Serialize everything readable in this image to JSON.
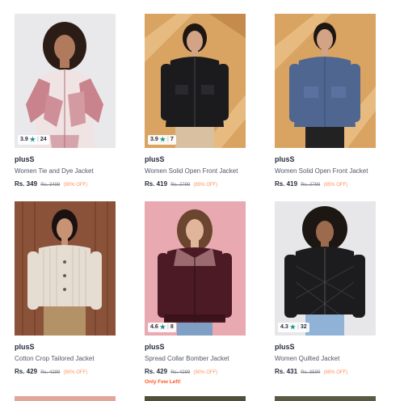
{
  "products": [
    {
      "brand": "plusS",
      "name": "Women Tie and Dye Jacket",
      "price": "Rs. 349",
      "mrp": "Rs. 3499",
      "off": "(90% OFF)",
      "rating": "3.9",
      "count": "24",
      "note": ""
    },
    {
      "brand": "plusS",
      "name": "Women Solid Open Front Jacket",
      "price": "Rs. 419",
      "mrp": "Rs. 2799",
      "off": "(85% OFF)",
      "rating": "3.9",
      "count": "7",
      "note": ""
    },
    {
      "brand": "plusS",
      "name": "Women Solid Open Front Jacket",
      "price": "Rs. 419",
      "mrp": "Rs. 2799",
      "off": "(85% OFF)",
      "rating": "",
      "count": "",
      "note": ""
    },
    {
      "brand": "plusS",
      "name": "Cotton Crop Tailored Jacket",
      "price": "Rs. 429",
      "mrp": "Rs. 4299",
      "off": "(90% OFF)",
      "rating": "",
      "count": "",
      "note": ""
    },
    {
      "brand": "plusS",
      "name": "Spread Collar Bomber Jacket",
      "price": "Rs. 429",
      "mrp": "Rs. 4299",
      "off": "(90% OFF)",
      "rating": "4.6",
      "count": "8",
      "note": "Only Few Left!"
    },
    {
      "brand": "plusS",
      "name": "Women Quilted Jacket",
      "price": "Rs. 431",
      "mrp": "Rs. 3599",
      "off": "(88% OFF)",
      "rating": "4.3",
      "count": "32",
      "note": ""
    }
  ],
  "colors": {
    "accent": "#ff905a",
    "star": "#14958f",
    "urgent": "#ff5722"
  }
}
